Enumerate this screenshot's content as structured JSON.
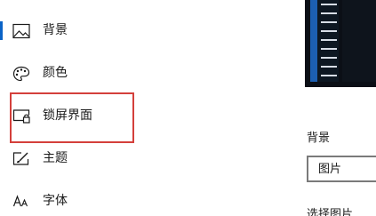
{
  "sidebar": {
    "items": [
      {
        "label": "背景",
        "icon": "picture-icon",
        "selected": true
      },
      {
        "label": "颜色",
        "icon": "palette-icon",
        "selected": false
      },
      {
        "label": "锁屏界面",
        "icon": "lock-screen-icon",
        "selected": false
      },
      {
        "label": "主题",
        "icon": "theme-icon",
        "selected": false
      },
      {
        "label": "字体",
        "icon": "font-icon",
        "selected": false
      }
    ]
  },
  "colors": {
    "accent": "#0a63c7",
    "highlight_box": "#d4403b",
    "preview_background": "#0b0f16"
  },
  "main": {
    "background_section_label": "背景",
    "background_select_value": "图片",
    "choose_picture_label": "选择图片"
  }
}
